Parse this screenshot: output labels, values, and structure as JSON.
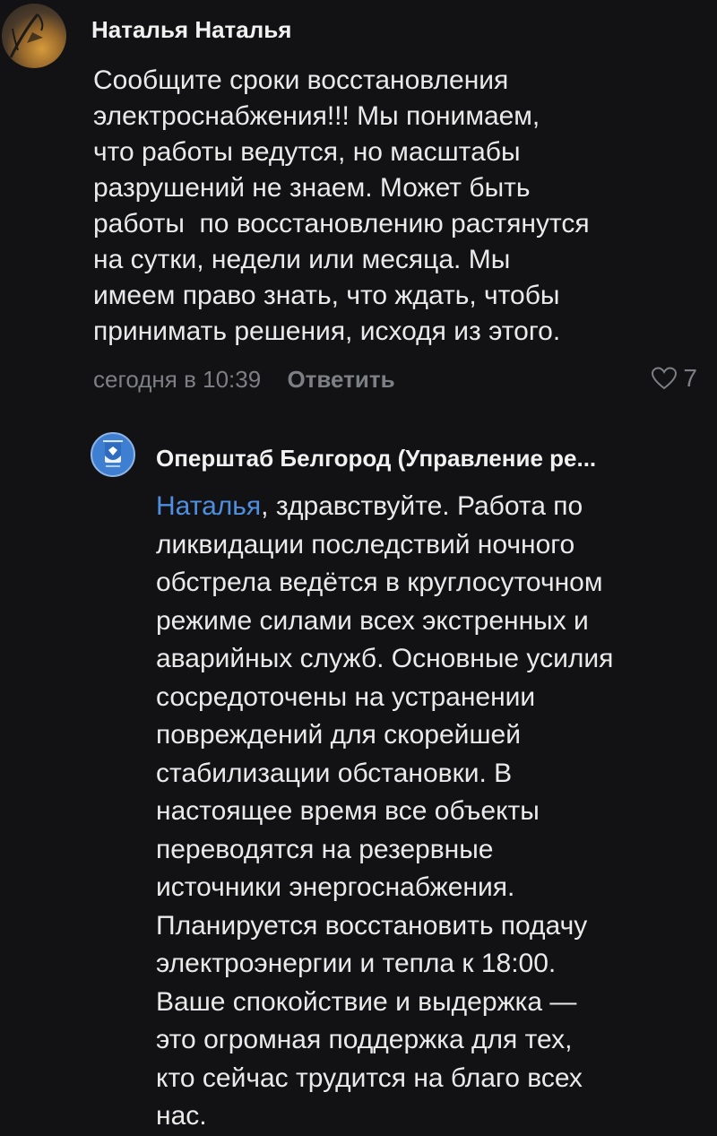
{
  "comment": {
    "author": "Наталья Наталья",
    "avatar_icon": "profile-photo",
    "text_lines": [
      "Сообщите сроки восстановления",
      "электроснабжения!!! Мы понимаем,",
      "что работы ведутся, но масштабы",
      "разрушений не знаем. Может быть",
      "работы  по восстановлению растянутся",
      "на сутки, недели или месяца. Мы",
      "имеем право знать, что ждать, чтобы",
      "принимать решения, исходя из этого."
    ],
    "timestamp": "сегодня в 10:39",
    "reply_label": "Ответить",
    "like_icon": "heart-outline-icon",
    "like_count": "7"
  },
  "reply": {
    "author": "Оперштаб Белгород (Управление ре...",
    "avatar_icon": "coat-of-arms-logo",
    "mention": "Наталья",
    "first_line_rest": ", здравствуйте. Работа по",
    "text_lines": [
      "ликвидации последствий ночного",
      "обстрела ведётся в круглосуточном",
      "режиме силами всех экстренных и",
      "аварийных служб. Основные усилия",
      "сосредоточены на устранении",
      "повреждений для скорейшей",
      "стабилизации обстановки. В",
      "настоящее время все объекты",
      "переводятся на резервные",
      "источники энергоснабжения.",
      "Планируется восстановить подачу",
      "электроэнергии и тепла к 18:00.",
      "Ваше спокойствие и выдержка —",
      "это огромная поддержка для тех,",
      "кто сейчас трудится на благо всех",
      "нас."
    ]
  },
  "colors": {
    "background": "#121214",
    "text": "#eaeaeb",
    "muted": "#7d7f84",
    "mention": "#4f8fe0",
    "logo_blue": "#3f7fd1"
  }
}
